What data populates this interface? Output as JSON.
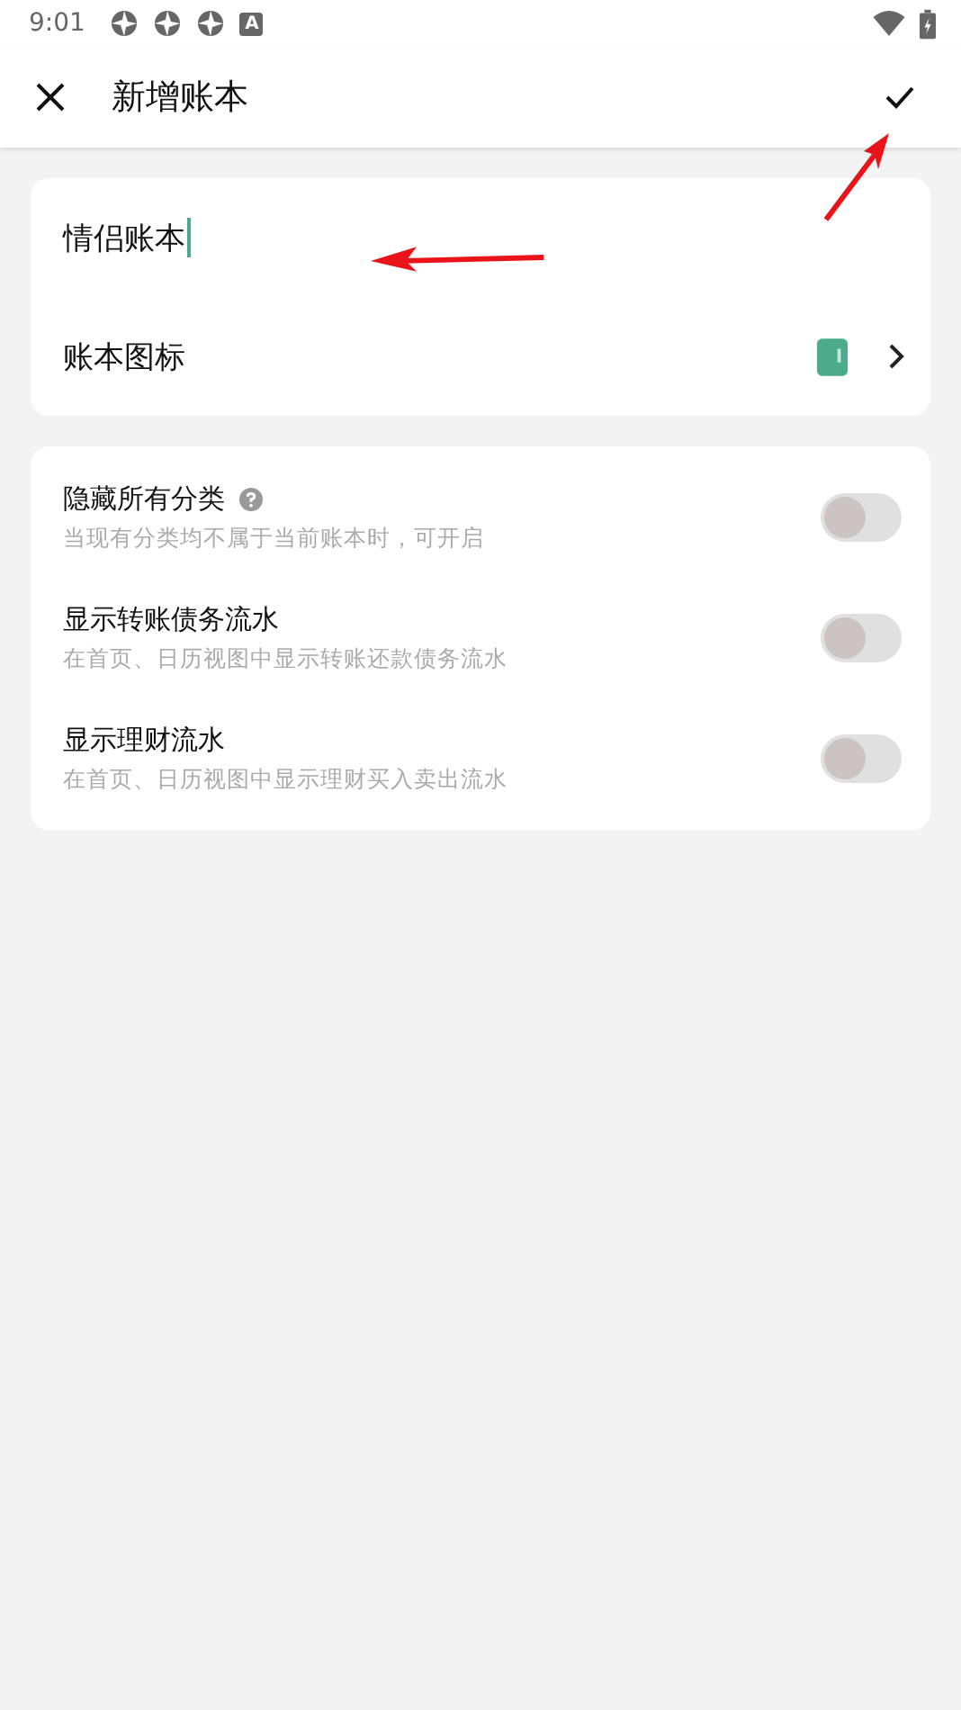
{
  "status_bar": {
    "time": "9:01",
    "notification_badge": "A"
  },
  "app_bar": {
    "title": "新增账本"
  },
  "book": {
    "name_value": "情侣账本",
    "icon_label": "账本图标"
  },
  "settings": [
    {
      "kind": "help",
      "title": "隐藏所有分类",
      "description": "当现有分类均不属于当前账本时，可开启",
      "on": false
    },
    {
      "kind": "plain",
      "title": "显示转账债务流水",
      "description": "在首页、日历视图中显示转账还款债务流水",
      "on": false
    },
    {
      "kind": "plain",
      "title": "显示理财流水",
      "description": "在首页、日历视图中显示理财买入卖出流水",
      "on": false
    }
  ]
}
